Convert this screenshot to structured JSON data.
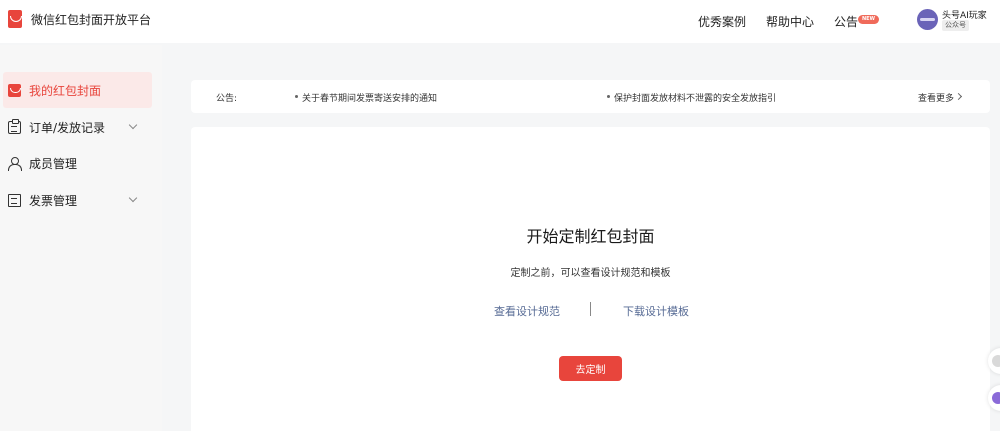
{
  "brand": {
    "title": "微信红包封面开放平台",
    "logo_icon": "red-packet-icon"
  },
  "header": {
    "nav": [
      {
        "label": "优秀案例"
      },
      {
        "label": "帮助中心"
      },
      {
        "label": "公告"
      }
    ],
    "announcement_badge": "NEW",
    "user": {
      "name": "头号AI玩家",
      "tag": "公众号"
    }
  },
  "sidebar": {
    "items": [
      {
        "label": "我的红包封面",
        "icon": "red-packet-icon",
        "active": true
      },
      {
        "label": "订单/发放记录",
        "icon": "clipboard-icon",
        "expandable": true
      },
      {
        "label": "成员管理",
        "icon": "person-icon"
      },
      {
        "label": "发票管理",
        "icon": "document-icon",
        "expandable": true
      }
    ]
  },
  "notice": {
    "label": "公告:",
    "items": [
      {
        "text": "关于春节期间发票寄送安排的通知"
      },
      {
        "text": "保护封面发放材料不泄露的安全发放指引"
      }
    ],
    "more_label": "查看更多"
  },
  "main": {
    "title": "开始定制红包封面",
    "subtitle": "定制之前，可以查看设计规范和模板",
    "links": [
      {
        "label": "查看设计规范"
      },
      {
        "label": "下载设计模板"
      }
    ],
    "cta_label": "去定制"
  },
  "colors": {
    "accent": "#e8453c",
    "link": "#576b95",
    "active_bg": "#fbe9e8"
  }
}
